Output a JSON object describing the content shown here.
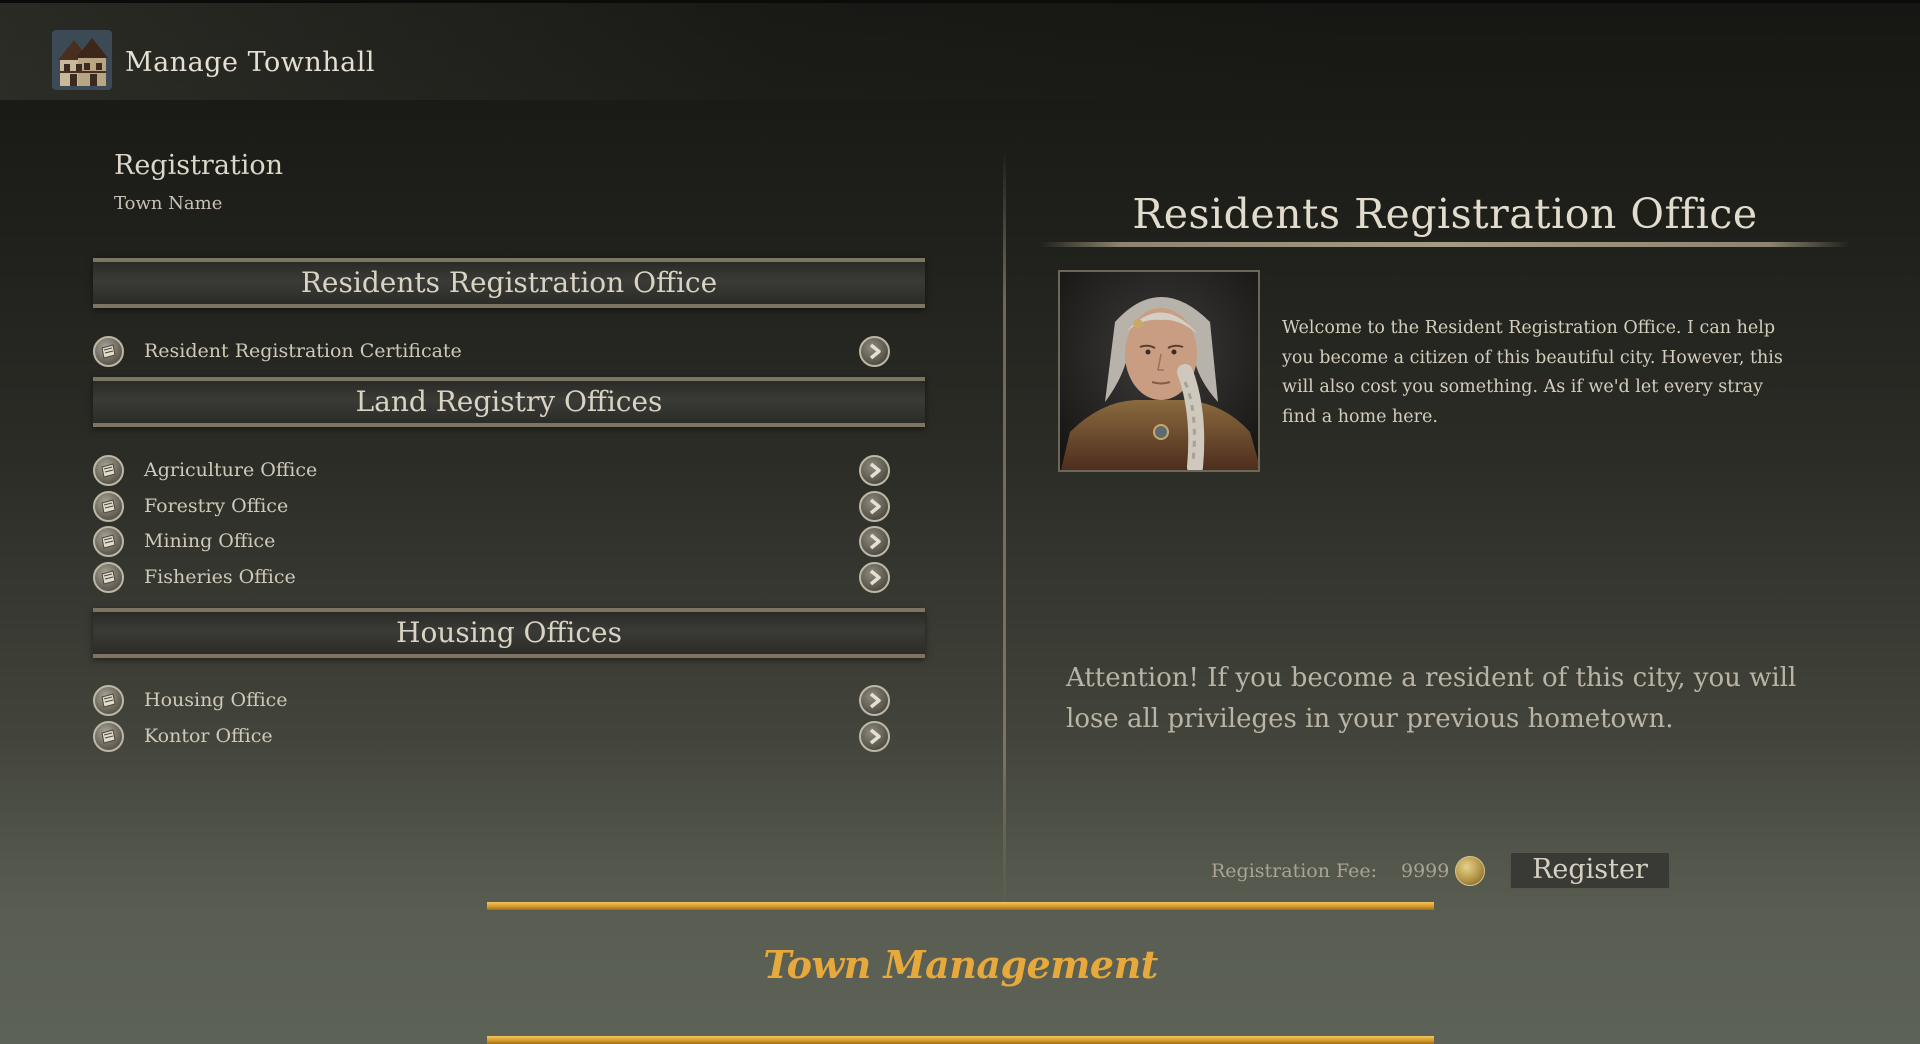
{
  "header": {
    "title": "Manage Townhall",
    "icon": "townhall-building-icon"
  },
  "left": {
    "registration_heading": "Registration",
    "town_name": "Town Name",
    "sections": [
      {
        "title": "Residents Registration Office",
        "items": [
          "Resident Registration Certificate"
        ]
      },
      {
        "title": "Land Registry Offices",
        "items": [
          "Agriculture Office",
          "Forestry Office",
          "Mining Office",
          "Fisheries Office"
        ]
      },
      {
        "title": "Housing Offices",
        "items": [
          "Housing Office",
          "Kontor Office"
        ]
      }
    ]
  },
  "right": {
    "office_title": "Residents Registration Office",
    "welcome_text": "Welcome to the Resident Registration Office. I can help you become a citizen of this beautiful city. However, this will also cost you something. As if we'd let every stray find a home here.",
    "attention_text": "Attention! If you become a resident of this city, you will lose all privileges in your previous hometown.",
    "fee_label": "Registration Fee:",
    "fee_value": "9999",
    "register_label": "Register"
  },
  "footer": {
    "title": "Town Management"
  },
  "colors": {
    "gold_accent": "#e7a93b",
    "banner_border": "#7d7562",
    "text_light": "#d8d2c2"
  }
}
